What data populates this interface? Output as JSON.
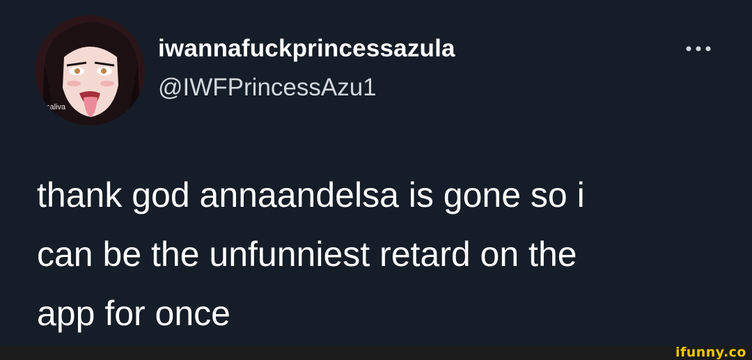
{
  "author": {
    "display_name": "iwannafuckprincessazula",
    "handle": "@IWFPrincessAzu1",
    "avatar_caption": "saliva"
  },
  "tweet": {
    "text": "thank god annaandelsa is gone so i\ncan be the unfunniest retard on the\napp for once"
  },
  "watermark": {
    "text": "ifunny.co",
    "color": "#f5c800"
  },
  "icons": {
    "more": "more-horizontal-icon"
  },
  "colors": {
    "background": "#151d28",
    "text_primary": "#ffffff",
    "text_secondary": "#d3d8de"
  }
}
